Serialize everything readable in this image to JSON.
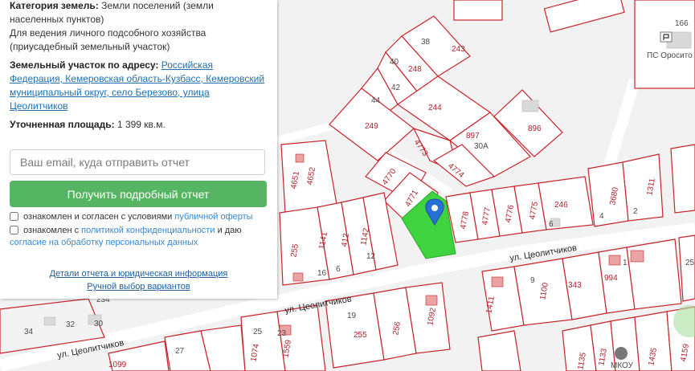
{
  "panel": {
    "category_label": "Категория земель:",
    "category_value": "Земли поселений (земли населенных пунктов)",
    "usage": "Для ведения личного подсобного хозяйства (приусадебный земельный участок)",
    "address_label": "Земельный участок по адресу:",
    "address_link": "Российская Федерация, Кемеровская область-Кузбасс, Кемеровский муниципальный округ, село Березово, улица Цеолитчиков",
    "area_label": "Уточненная площадь:",
    "area_value": "1 399 кв.м.",
    "email_placeholder": "Ваш email, куда отправить отчет",
    "submit_label": "Получить подробный отчет",
    "consent1_text": "ознакомлен и согласен с условиями",
    "consent1_link": "публичной оферты",
    "consent2_text": "ознакомлен с",
    "consent2_link": "политикой конфиденциальности",
    "consent2_mid": "и даю",
    "consent2_link2": "согласие на обработку персональных данных",
    "details_link": "Детали отчета и юридическая информация",
    "manual_link": "Ручной выбор вариантов"
  },
  "map": {
    "street_labels": [
      "ул. Цеолитчиков",
      "ул. Цеолитчиков",
      "ул. Цеолитчиков"
    ],
    "poi_label": "ПС Оросито",
    "school_label": "МКОУ",
    "plot_labels": [
      "38",
      "243",
      "248",
      "40",
      "42",
      "44",
      "244",
      "249",
      "4773",
      "897",
      "30А",
      "896",
      "4774",
      "4770",
      "4771",
      "4778",
      "4777",
      "4776",
      "4775",
      "246",
      "6",
      "3680",
      "1311",
      "4",
      "2",
      "4651",
      "4652",
      "255",
      "1141",
      "412",
      "1142",
      "12",
      "16",
      "6",
      "1411",
      "9",
      "1100",
      "343",
      "994",
      "25",
      "32",
      "34",
      "30",
      "234",
      "1099",
      "27",
      "1074",
      "1559",
      "23",
      "25",
      "19",
      "1092",
      "255",
      "256",
      "1135",
      "1133",
      "2",
      "1435",
      "4159",
      "166",
      "1"
    ],
    "selected_color": "#3fd43f",
    "marker_color": "#2a6fd6"
  }
}
